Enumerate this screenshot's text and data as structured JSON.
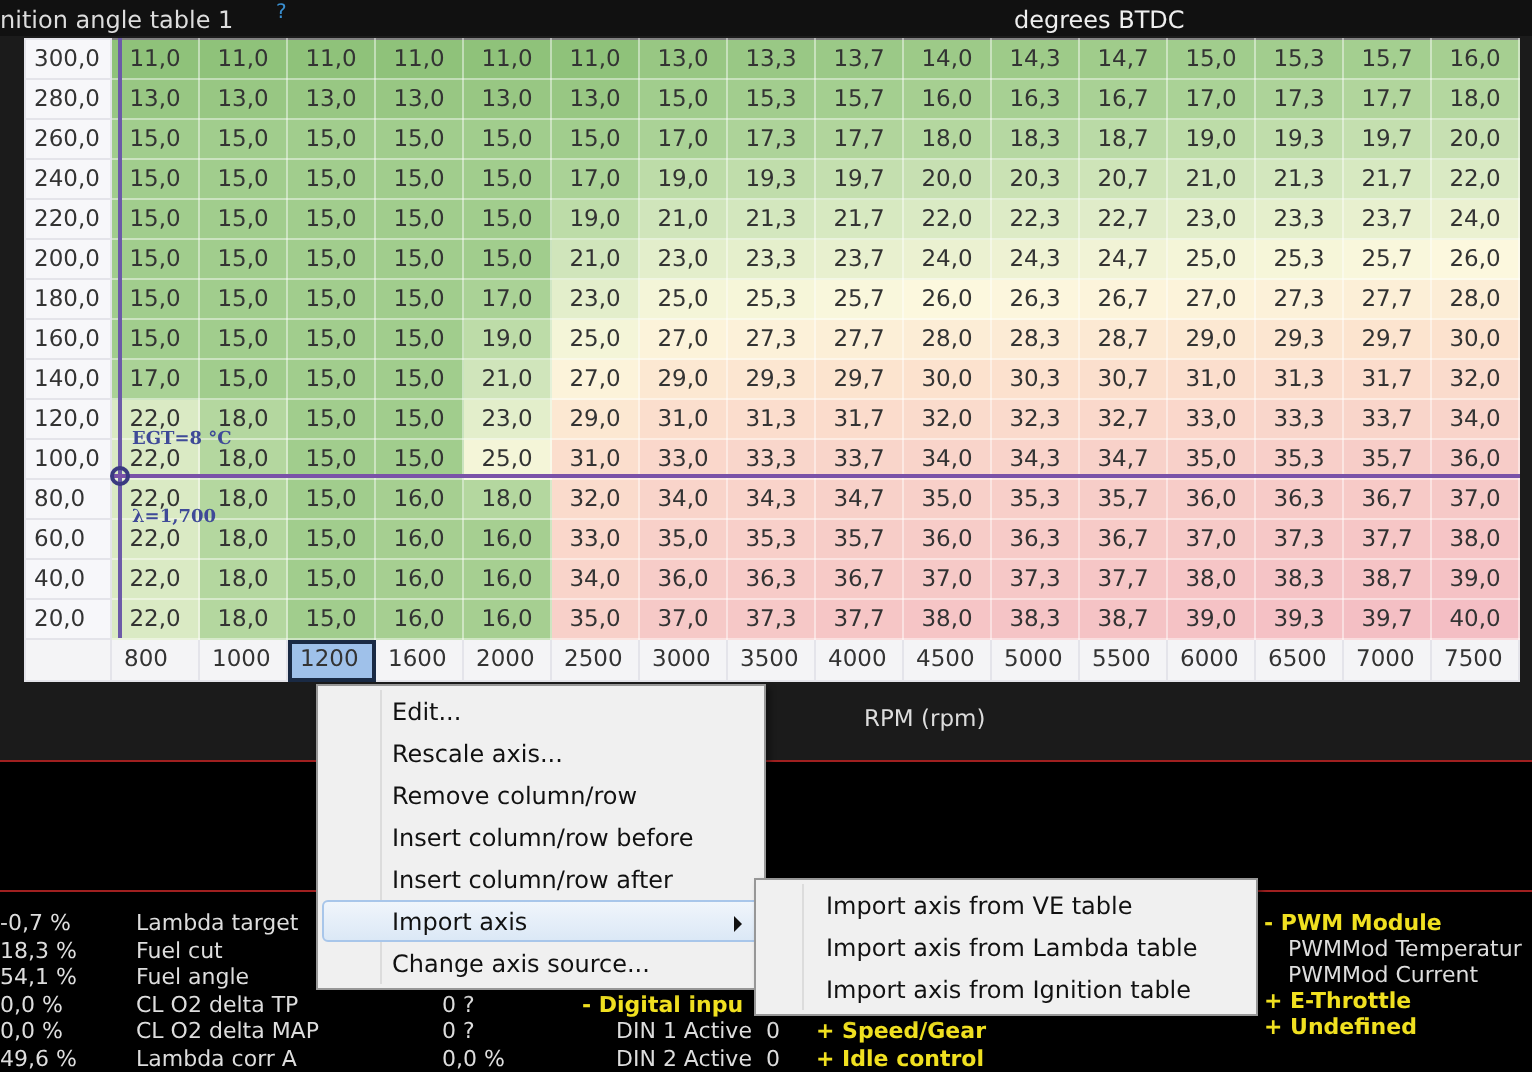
{
  "header": {
    "title": "nition angle table 1",
    "help": "?",
    "unit": "degrees BTDC"
  },
  "table": {
    "rows": [
      {
        "label": "300,0",
        "cells": [
          "11,0",
          "11,0",
          "11,0",
          "11,0",
          "11,0",
          "11,0",
          "13,0",
          "13,3",
          "13,7",
          "14,0",
          "14,3",
          "14,7",
          "15,0",
          "15,3",
          "15,7",
          "16,0"
        ]
      },
      {
        "label": "280,0",
        "cells": [
          "13,0",
          "13,0",
          "13,0",
          "13,0",
          "13,0",
          "13,0",
          "15,0",
          "15,3",
          "15,7",
          "16,0",
          "16,3",
          "16,7",
          "17,0",
          "17,3",
          "17,7",
          "18,0"
        ]
      },
      {
        "label": "260,0",
        "cells": [
          "15,0",
          "15,0",
          "15,0",
          "15,0",
          "15,0",
          "15,0",
          "17,0",
          "17,3",
          "17,7",
          "18,0",
          "18,3",
          "18,7",
          "19,0",
          "19,3",
          "19,7",
          "20,0"
        ]
      },
      {
        "label": "240,0",
        "cells": [
          "15,0",
          "15,0",
          "15,0",
          "15,0",
          "15,0",
          "17,0",
          "19,0",
          "19,3",
          "19,7",
          "20,0",
          "20,3",
          "20,7",
          "21,0",
          "21,3",
          "21,7",
          "22,0"
        ]
      },
      {
        "label": "220,0",
        "cells": [
          "15,0",
          "15,0",
          "15,0",
          "15,0",
          "15,0",
          "19,0",
          "21,0",
          "21,3",
          "21,7",
          "22,0",
          "22,3",
          "22,7",
          "23,0",
          "23,3",
          "23,7",
          "24,0"
        ]
      },
      {
        "label": "200,0",
        "cells": [
          "15,0",
          "15,0",
          "15,0",
          "15,0",
          "15,0",
          "21,0",
          "23,0",
          "23,3",
          "23,7",
          "24,0",
          "24,3",
          "24,7",
          "25,0",
          "25,3",
          "25,7",
          "26,0"
        ]
      },
      {
        "label": "180,0",
        "cells": [
          "15,0",
          "15,0",
          "15,0",
          "15,0",
          "17,0",
          "23,0",
          "25,0",
          "25,3",
          "25,7",
          "26,0",
          "26,3",
          "26,7",
          "27,0",
          "27,3",
          "27,7",
          "28,0"
        ]
      },
      {
        "label": "160,0",
        "cells": [
          "15,0",
          "15,0",
          "15,0",
          "15,0",
          "19,0",
          "25,0",
          "27,0",
          "27,3",
          "27,7",
          "28,0",
          "28,3",
          "28,7",
          "29,0",
          "29,3",
          "29,7",
          "30,0"
        ]
      },
      {
        "label": "140,0",
        "cells": [
          "17,0",
          "15,0",
          "15,0",
          "15,0",
          "21,0",
          "27,0",
          "29,0",
          "29,3",
          "29,7",
          "30,0",
          "30,3",
          "30,7",
          "31,0",
          "31,3",
          "31,7",
          "32,0"
        ]
      },
      {
        "label": "120,0",
        "cells": [
          "22,0",
          "18,0",
          "15,0",
          "15,0",
          "23,0",
          "29,0",
          "31,0",
          "31,3",
          "31,7",
          "32,0",
          "32,3",
          "32,7",
          "33,0",
          "33,3",
          "33,7",
          "34,0"
        ]
      },
      {
        "label": "100,0",
        "cells": [
          "22,0",
          "18,0",
          "15,0",
          "15,0",
          "25,0",
          "31,0",
          "33,0",
          "33,3",
          "33,7",
          "34,0",
          "34,3",
          "34,7",
          "35,0",
          "35,3",
          "35,7",
          "36,0"
        ]
      },
      {
        "label": "80,0",
        "cells": [
          "22,0",
          "18,0",
          "15,0",
          "16,0",
          "18,0",
          "32,0",
          "34,0",
          "34,3",
          "34,7",
          "35,0",
          "35,3",
          "35,7",
          "36,0",
          "36,3",
          "36,7",
          "37,0"
        ]
      },
      {
        "label": "60,0",
        "cells": [
          "22,0",
          "18,0",
          "15,0",
          "16,0",
          "16,0",
          "33,0",
          "35,0",
          "35,3",
          "35,7",
          "36,0",
          "36,3",
          "36,7",
          "37,0",
          "37,3",
          "37,7",
          "38,0"
        ]
      },
      {
        "label": "40,0",
        "cells": [
          "22,0",
          "18,0",
          "15,0",
          "16,0",
          "16,0",
          "34,0",
          "36,0",
          "36,3",
          "36,7",
          "37,0",
          "37,3",
          "37,7",
          "38,0",
          "38,3",
          "38,7",
          "39,0"
        ]
      },
      {
        "label": "20,0",
        "cells": [
          "22,0",
          "18,0",
          "15,0",
          "16,0",
          "16,0",
          "35,0",
          "37,0",
          "37,3",
          "37,7",
          "38,0",
          "38,3",
          "38,7",
          "39,0",
          "39,3",
          "39,7",
          "40,0"
        ]
      }
    ],
    "x_axis": [
      {
        "label": "800",
        "selected": false
      },
      {
        "label": "1000",
        "selected": false
      },
      {
        "label": "1200",
        "selected": true
      },
      {
        "label": "1600",
        "selected": false
      },
      {
        "label": "2000",
        "selected": false
      },
      {
        "label": "2500",
        "selected": false
      },
      {
        "label": "3000",
        "selected": false
      },
      {
        "label": "3500",
        "selected": false
      },
      {
        "label": "4000",
        "selected": false
      },
      {
        "label": "4500",
        "selected": false
      },
      {
        "label": "5000",
        "selected": false
      },
      {
        "label": "5500",
        "selected": false
      },
      {
        "label": "6000",
        "selected": false
      },
      {
        "label": "6500",
        "selected": false
      },
      {
        "label": "7000",
        "selected": false
      },
      {
        "label": "7500",
        "selected": false
      }
    ],
    "x_title": "RPM (rpm)",
    "cursor": {
      "egt": "EGT=8 °C",
      "lambda": "λ=1,700"
    }
  },
  "monitor": {
    "rows": [
      {
        "value": "-0,7 %",
        "name": "Lambda target"
      },
      {
        "value": "18,3 %",
        "name": "Fuel cut"
      },
      {
        "value": "54,1 %",
        "name": "Fuel angle"
      },
      {
        "value": "0,0 %",
        "name": "CL O2 delta TP",
        "reading": "0 ?",
        "entry": {
          "kind": "group",
          "text": "- Digital inpu"
        }
      },
      {
        "value": "0,0 %",
        "name": "CL O2 delta MAP",
        "reading": "0 ?",
        "entry": {
          "kind": "item",
          "text": "DIN 1 Active"
        },
        "entry_value": "0",
        "next": "+ Speed/Gear"
      },
      {
        "value": "49,6 %",
        "name": "Lambda corr A",
        "reading": "0,0 %",
        "entry": {
          "kind": "item",
          "text": "DIN 2 Active"
        },
        "entry_value": "0",
        "next": "+ Idle control"
      }
    ],
    "tree": [
      {
        "kind": "group",
        "text": "- PWM Module"
      },
      {
        "kind": "item",
        "text": "PWMMod Temperatur"
      },
      {
        "kind": "item",
        "text": "PWMMod Current"
      },
      {
        "kind": "group",
        "text": "+ E-Throttle"
      },
      {
        "kind": "group",
        "text": "+ Undefined"
      }
    ]
  },
  "context_menu": {
    "items": [
      {
        "label": "Edit...",
        "highlighted": false,
        "submenu": false
      },
      {
        "label": "Rescale axis...",
        "highlighted": false,
        "submenu": false
      },
      {
        "label": "Remove column/row",
        "highlighted": false,
        "submenu": false
      },
      {
        "label": "Insert column/row before",
        "highlighted": false,
        "submenu": false
      },
      {
        "label": "Insert column/row after",
        "highlighted": false,
        "submenu": false
      },
      {
        "label": "Import axis",
        "highlighted": true,
        "submenu": true
      },
      {
        "label": "Change axis source...",
        "highlighted": false,
        "submenu": false
      }
    ],
    "submenu": [
      "Import axis from VE table",
      "Import axis from Lambda table",
      "Import axis from Ignition table"
    ]
  }
}
